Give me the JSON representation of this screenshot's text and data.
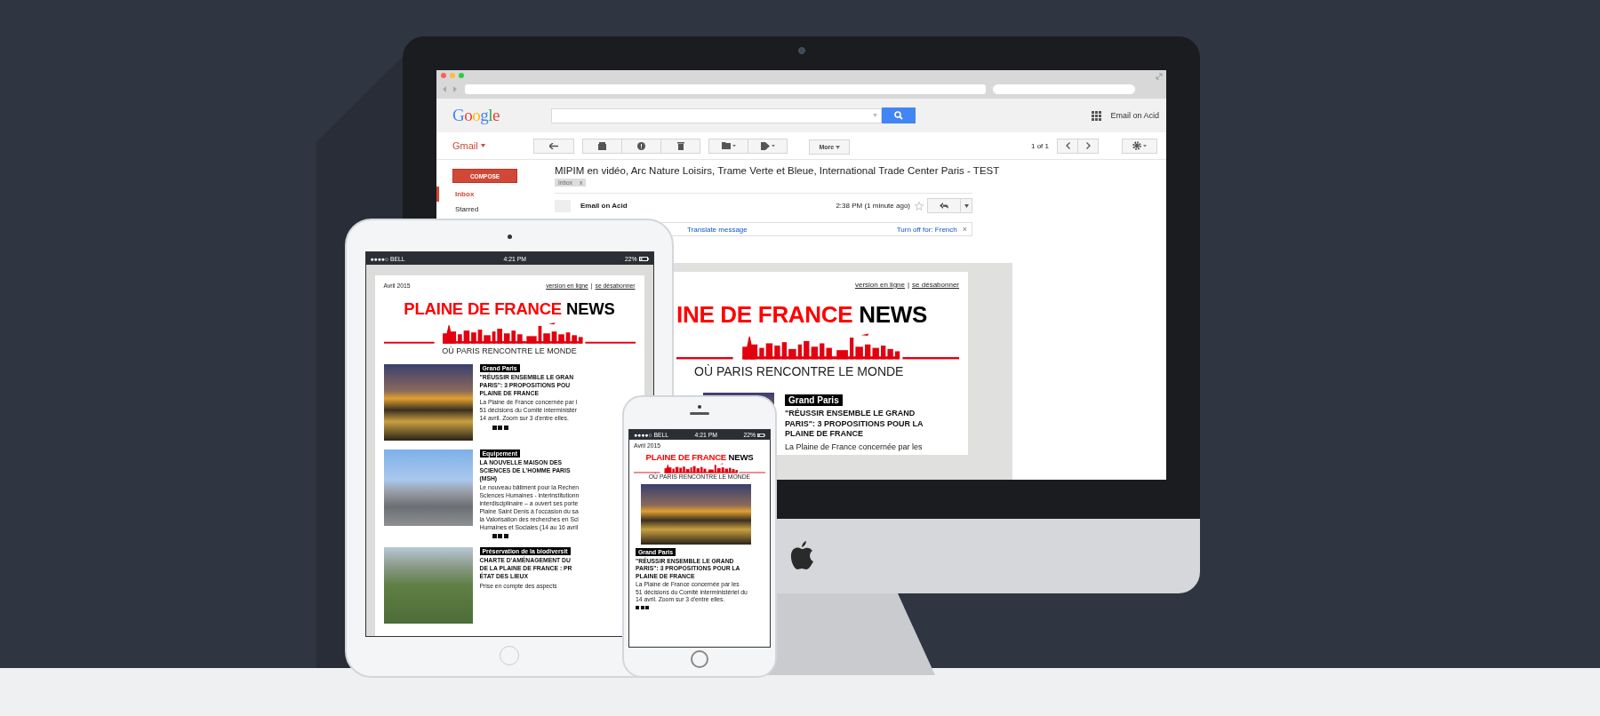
{
  "desktop": {
    "gmail": {
      "logo": "Google",
      "account": "Email on Acid",
      "app_name": "Gmail",
      "compose": "COMPOSE",
      "folders": [
        {
          "label": "Inbox",
          "selected": true
        },
        {
          "label": "Starred",
          "selected": false
        }
      ],
      "more_button": "More",
      "pagination": "1 of 1",
      "message": {
        "subject": "MIPIM en vidéo, Arc Nature Loisirs, Trame Verte et Bleue, International Trade Center Paris - TEST",
        "label": "Inbox",
        "label_remove": "x",
        "sender": "Email on Acid",
        "time": "2:38 PM (1 minute ago)",
        "starred": false,
        "translate": "Translate message",
        "turn_off": "Turn off for: French",
        "dismiss": "×"
      }
    },
    "newsletter": {
      "links": [
        "version en ligne",
        "se désabonner"
      ],
      "link_separator": "|",
      "title_red": "INE DE FRANCE",
      "title_black": "NEWS",
      "tagline": "OÙ **PARIS** RENCONTRE **LE MONDE**",
      "article": {
        "tag": "Grand Paris",
        "headline": "\"RÉUSSIR ENSEMBLE LE GRAND\nPARIS\": 3 PROPOSITIONS POUR LA\nPLAINE DE FRANCE",
        "summary": "La Plaine de France concernée par les"
      }
    }
  },
  "tablet": {
    "status": {
      "carrier": "●●●●○ BELL",
      "time": "4:21 PM",
      "battery": "22%"
    },
    "newsletter": {
      "date": "Avril 2015",
      "links": [
        "version en ligne",
        "se désabonner"
      ],
      "link_separator": "|",
      "title_red": "PLAINE DE FRANCE",
      "title_black": "NEWS",
      "tagline": "OÙ **PARIS** RENCONTRE **LE MONDE**",
      "articles": [
        {
          "tag": "Grand Paris",
          "headline": "\"RÉUSSIR ENSEMBLE LE GRAN\nPARIS\": 3 PROPOSITIONS POU\nPLAINE DE FRANCE",
          "summary": "La Plaine de France concernée par l\n51 décisions du Comité interministér\n14 avril. Zoom sur 3 d'entre elles."
        },
        {
          "tag": "Equipement",
          "headline": "LA NOUVELLE MAISON DES\nSCIENCES DE L'HOMME PARIS\n(MSH)",
          "summary": "Le nouveau bâtiment pour la Rechen\nSciences Humaines - interinstitutionn\ninterdisciplinaire – a ouvert ses porte\nPlaine Saint Denis à l'occasion du sa\nla Valorisation des recherches en Sci\nHumaines et Sociales (14 au 16 avril"
        },
        {
          "tag": "Préservation de la biodiversit",
          "headline": "CHARTE D'AMÉNAGEMENT DU\nDE LA PLAINE DE FRANCE : PR\nÉTAT DES LIEUX",
          "summary": "Prise en compte des aspects"
        }
      ]
    }
  },
  "phone": {
    "status": {
      "carrier": "●●●●○ BELL",
      "time": "4:21 PM",
      "battery": "22%"
    },
    "newsletter": {
      "date": "Avril 2015",
      "title_red": "PLAINE DE FRANCE",
      "title_black": "NEWS",
      "tagline": "OÙ **PARIS** RENCONTRE **LE MONDE**",
      "article": {
        "tag": "Grand Paris",
        "headline": "\"RÉUSSIR ENSEMBLE LE GRAND\nPARIS\": 3 PROPOSITIONS POUR LA\nPLAINE DE FRANCE",
        "summary": "La Plaine de France concernée par les\n51 décisions du Comité interministériel du\n14 avril. Zoom sur 3 d'entre elles."
      }
    }
  }
}
